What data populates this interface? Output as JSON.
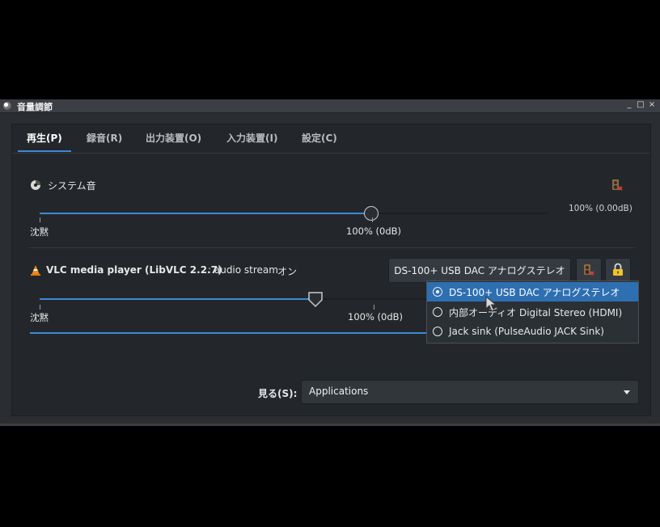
{
  "window": {
    "title": "音量調節",
    "controls": {
      "minimize": "_",
      "maximize": "□",
      "close": "×"
    }
  },
  "tabs": [
    {
      "label": "再生(P)",
      "active": true
    },
    {
      "label": "録音(R)"
    },
    {
      "label": "出力装置(O)"
    },
    {
      "label": "入力装置(I)"
    },
    {
      "label": "設定(C)"
    }
  ],
  "system_sound": {
    "label": "システム音",
    "value_text": "100% (0.00dB)",
    "min_label": "沈黙",
    "mid_label": "100% (0dB)",
    "level_percent": 100
  },
  "vlc": {
    "name": "VLC media player (LibVLC 2.2.7)",
    "stream": ": audio stream",
    "state": "オン",
    "device_button": "DS-100+ USB DAC アナログステレオ",
    "min_label": "沈黙",
    "mid_label": "100% (0dB)",
    "level_percent": 85
  },
  "device_menu": [
    {
      "label": "DS-100+ USB DAC アナログステレオ",
      "selected": true
    },
    {
      "label": "内部オーディオ Digital Stereo (HDMI)",
      "selected": false
    },
    {
      "label": "Jack sink (PulseAudio JACK Sink)",
      "selected": false
    }
  ],
  "show": {
    "label": "見る(S):",
    "value": "Applications"
  },
  "colors": {
    "accent": "#3c89d6",
    "selection": "#2e6fb2",
    "background": "#23272b"
  }
}
